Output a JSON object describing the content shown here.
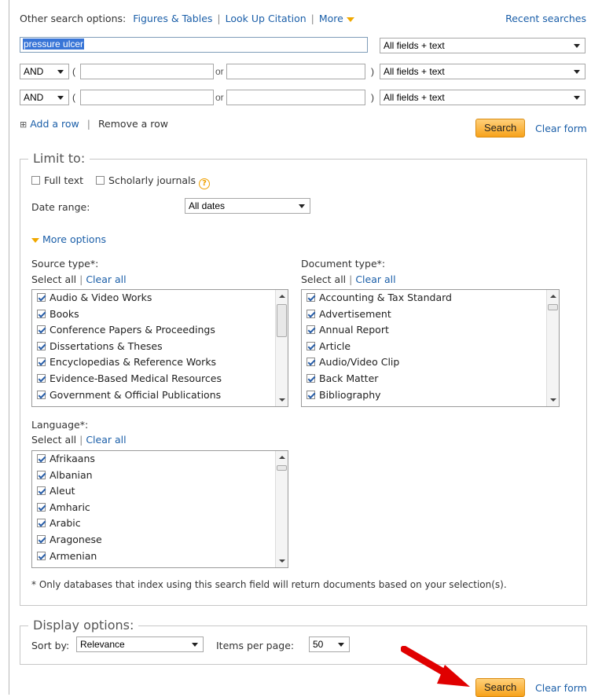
{
  "top": {
    "prefix": "Other search options:",
    "figures": "Figures & Tables",
    "lookup": "Look Up Citation",
    "more": "More",
    "recent": "Recent searches"
  },
  "query": {
    "row1_value": "pressure ulcer",
    "field_select": "All fields + text",
    "operator": "AND",
    "open_paren": "(",
    "close_paren": ")",
    "or": "or"
  },
  "rows": {
    "add": "Add a row",
    "remove": "Remove a row",
    "plus_glyph": "⊞"
  },
  "buttons": {
    "search": "Search",
    "clear": "Clear form"
  },
  "limit": {
    "legend": "Limit to:",
    "full_text": "Full text",
    "scholarly": "Scholarly journals",
    "help_glyph": "?",
    "date_label": "Date range:",
    "date_value": "All dates",
    "more_options": "More options"
  },
  "source": {
    "label": "Source type*:",
    "select_all": "Select all",
    "clear_all": "Clear all",
    "items": [
      "Audio & Video Works",
      "Books",
      "Conference Papers & Proceedings",
      "Dissertations & Theses",
      "Encyclopedias & Reference Works",
      "Evidence-Based Medical Resources",
      "Government & Official Publications"
    ]
  },
  "doctype": {
    "label": "Document type*:",
    "select_all": "Select all",
    "clear_all": "Clear all",
    "items": [
      "Accounting & Tax Standard",
      "Advertisement",
      "Annual Report",
      "Article",
      "Audio/Video Clip",
      "Back Matter",
      "Bibliography"
    ]
  },
  "language": {
    "label": "Language*:",
    "select_all": "Select all",
    "clear_all": "Clear all",
    "items": [
      "Afrikaans",
      "Albanian",
      "Aleut",
      "Amharic",
      "Arabic",
      "Aragonese",
      "Armenian"
    ]
  },
  "footnote": "* Only databases that index using this search field will return documents based on your selection(s).",
  "display": {
    "legend": "Display options:",
    "sort_label": "Sort by:",
    "sort_value": "Relevance",
    "items_label": "Items per page:",
    "items_value": "50"
  },
  "colors": {
    "link": "#1a5ea8",
    "accent_orange": "#f7a21b",
    "arrow_red": "#e00000"
  }
}
